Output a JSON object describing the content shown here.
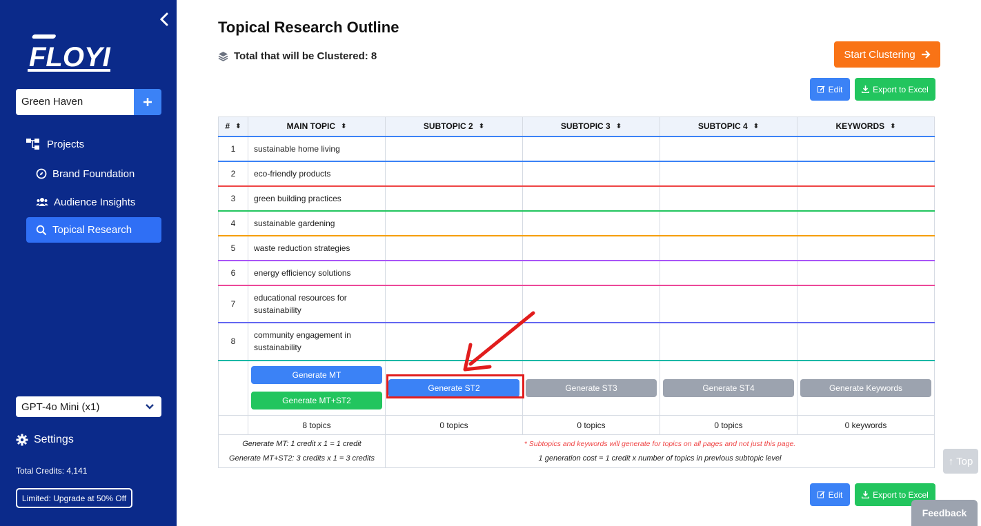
{
  "sidebar": {
    "logo_text": "FLOYI",
    "project_name": "Green Haven",
    "nav": [
      {
        "label": "Projects",
        "icon": "sitemap-icon"
      },
      {
        "label": "Brand Foundation",
        "icon": "compass-icon"
      },
      {
        "label": "Audience Insights",
        "icon": "users-icon"
      },
      {
        "label": "Topical Research",
        "icon": "search-icon",
        "active": true
      }
    ],
    "model": "GPT-4o Mini (x1)",
    "settings_label": "Settings",
    "credits": "Total Credits: 4,141",
    "upgrade": "Limited: Upgrade at 50% Off",
    "color": "#0b2a8a"
  },
  "main": {
    "title": "Topical Research Outline",
    "total_label": "Total that will be Clustered: 8",
    "start_button": "Start Clustering",
    "edit_label": "Edit",
    "export_label": "Export to Excel"
  },
  "table": {
    "headers": [
      "#",
      "MAIN TOPIC",
      "SUBTOPIC 2",
      "SUBTOPIC 3",
      "SUBTOPIC 4",
      "KEYWORDS"
    ],
    "rows": [
      {
        "num": "1",
        "topic": "sustainable home living"
      },
      {
        "num": "2",
        "topic": "eco-friendly products"
      },
      {
        "num": "3",
        "topic": "green building practices"
      },
      {
        "num": "4",
        "topic": "sustainable gardening"
      },
      {
        "num": "5",
        "topic": "waste reduction strategies"
      },
      {
        "num": "6",
        "topic": "energy efficiency solutions"
      },
      {
        "num": "7",
        "topic": "educational resources for sustainability"
      },
      {
        "num": "8",
        "topic": "community engagement in sustainability"
      }
    ],
    "buttons": {
      "gen_mt": "Generate MT",
      "gen_mt_st2": "Generate MT+ST2",
      "gen_st2": "Generate ST2",
      "gen_st3": "Generate ST3",
      "gen_st4": "Generate ST4",
      "gen_keywords": "Generate Keywords"
    },
    "counts": [
      "8 topics",
      "0 topics",
      "0 topics",
      "0 topics",
      "0 keywords"
    ],
    "notes": {
      "mt_cost": "Generate MT: 1 credit x 1 = 1 credit",
      "mt_st2_cost": "Generate MT+ST2: 3 credits x 1 = 3 credits",
      "warning": "* Subtopics and keywords will generate for topics on all pages and not just this page.",
      "gen_cost": "1 generation cost = 1 credit x number of topics in previous subtopic level"
    }
  },
  "floating": {
    "top_label": "↑ Top",
    "feedback_label": "Feedback"
  },
  "colors": {
    "accent": "#3b82f6",
    "success": "#22c55e",
    "orange": "#f97316",
    "highlight": "#e11d1d"
  }
}
